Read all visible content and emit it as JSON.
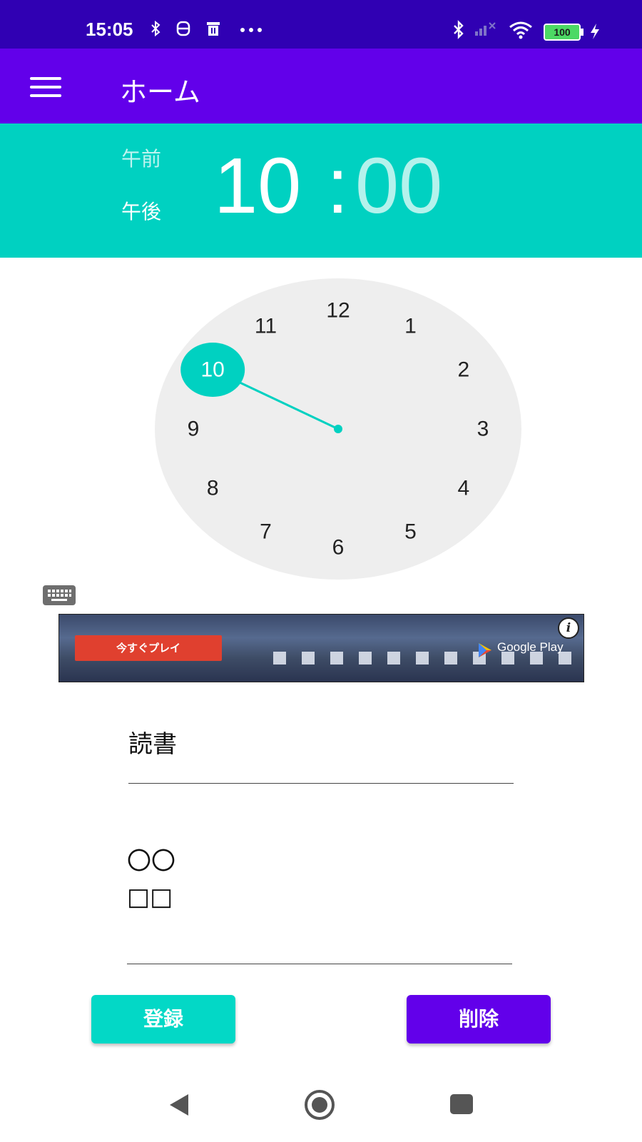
{
  "status_bar": {
    "time": "15:05",
    "battery": "100"
  },
  "app_bar": {
    "title": "ホーム"
  },
  "time_picker": {
    "am_label": "午前",
    "pm_label": "午後",
    "hour": "10",
    "separator": ":",
    "minute": "00"
  },
  "clock": {
    "numbers": [
      "12",
      "1",
      "2",
      "3",
      "4",
      "5",
      "6",
      "7",
      "8",
      "9",
      "10",
      "11"
    ],
    "selected": "10"
  },
  "ad": {
    "cta_label": "今すぐプレイ",
    "store_label": "Google Play",
    "info_label": "i"
  },
  "form": {
    "title_value": "読書",
    "memo_lines": [
      "〇〇",
      "□□"
    ]
  },
  "buttons": {
    "register_label": "登録",
    "delete_label": "削除"
  },
  "colors": {
    "status_bar": "#3000b3",
    "app_bar": "#6200ea",
    "accent_teal": "#00d1c1",
    "delete_button": "#6200ea",
    "register_button": "#03d8c6"
  }
}
